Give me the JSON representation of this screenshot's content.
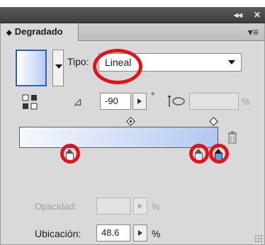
{
  "titlebar": {
    "collapse_icon": "double-chevron-left-icon",
    "collapse_glyph": "◂◂",
    "close_glyph": "✕"
  },
  "panel": {
    "tab_label": "Degradado",
    "menu_icon": "panel-menu-icon",
    "tipo_label": "Tipo:",
    "tipo_value": "Lineal",
    "angle_value": "-90",
    "degree_symbol": "°",
    "aspect_pct": "%",
    "opacity_label": "Opacidad:",
    "opacity_pct": "%",
    "location_label": "Ubicación:",
    "location_value": "48.6",
    "location_pct": "%"
  },
  "gradient": {
    "start_color": "#f6f8fd",
    "end_color": "#b3c8f2",
    "stops": 3
  },
  "highlight_color": "#e0141e"
}
